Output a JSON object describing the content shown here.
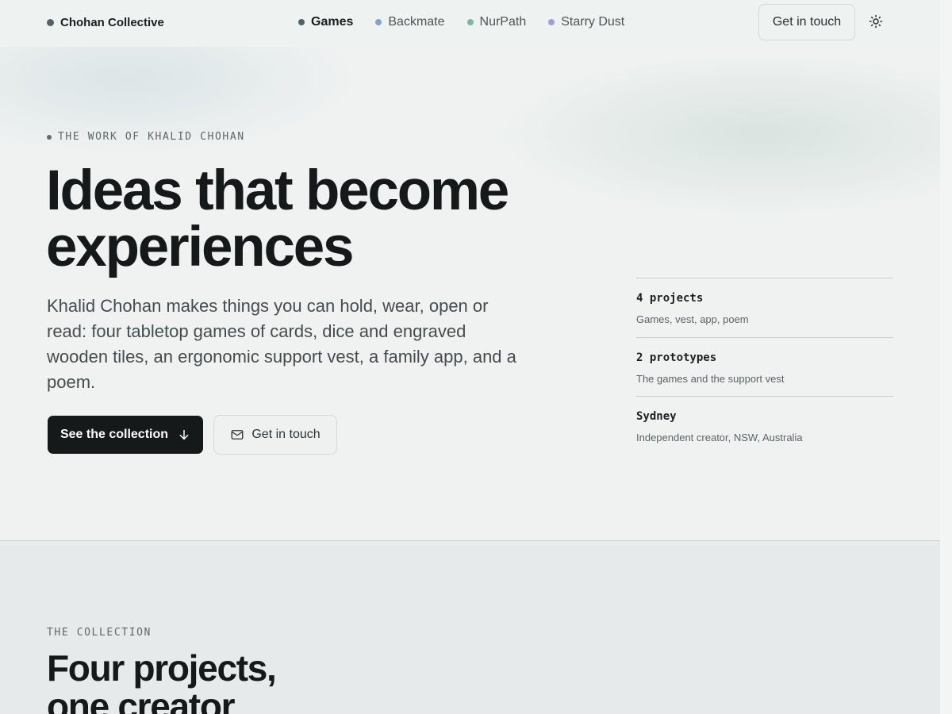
{
  "header": {
    "brand": "Chohan Collective",
    "nav": [
      {
        "label": "Games",
        "color": "#4f6469",
        "active": true
      },
      {
        "label": "Backmate",
        "color": "#7da6d1"
      },
      {
        "label": "NurPath",
        "color": "#7fb7a0"
      },
      {
        "label": "Starry Dust",
        "color": "#9aa3d6"
      }
    ],
    "contact_label": "Get in touch",
    "theme_icon": "sun-icon"
  },
  "hero": {
    "eyebrow": "THE WORK OF KHALID CHOHAN",
    "headline_line1": "Ideas that become",
    "headline_line2": "experiences",
    "lede": "Khalid Chohan makes things you can hold, wear, open or read: four tabletop games of cards, dice and engraved wooden tiles, an ergonomic support vest, a family app, and a poem.",
    "primary_label": "See the collection",
    "primary_icon": "arrow-down-icon",
    "secondary_label": "Get in touch",
    "secondary_icon": "mail-icon"
  },
  "stats": [
    {
      "title": "4 projects",
      "subtitle": "Games, vest, app, poem"
    },
    {
      "title": "2 prototypes",
      "subtitle": "The games and the support vest"
    },
    {
      "title": "Sydney",
      "subtitle": "Independent creator, NSW, Australia"
    }
  ],
  "collection": {
    "eyebrow": "THE COLLECTION",
    "title_line1": "Four projects,",
    "title_line2": "one creator"
  },
  "colors": {
    "brand_dot": "#4f6469",
    "primary_button": "#15191a",
    "background": "#eef1f0"
  }
}
